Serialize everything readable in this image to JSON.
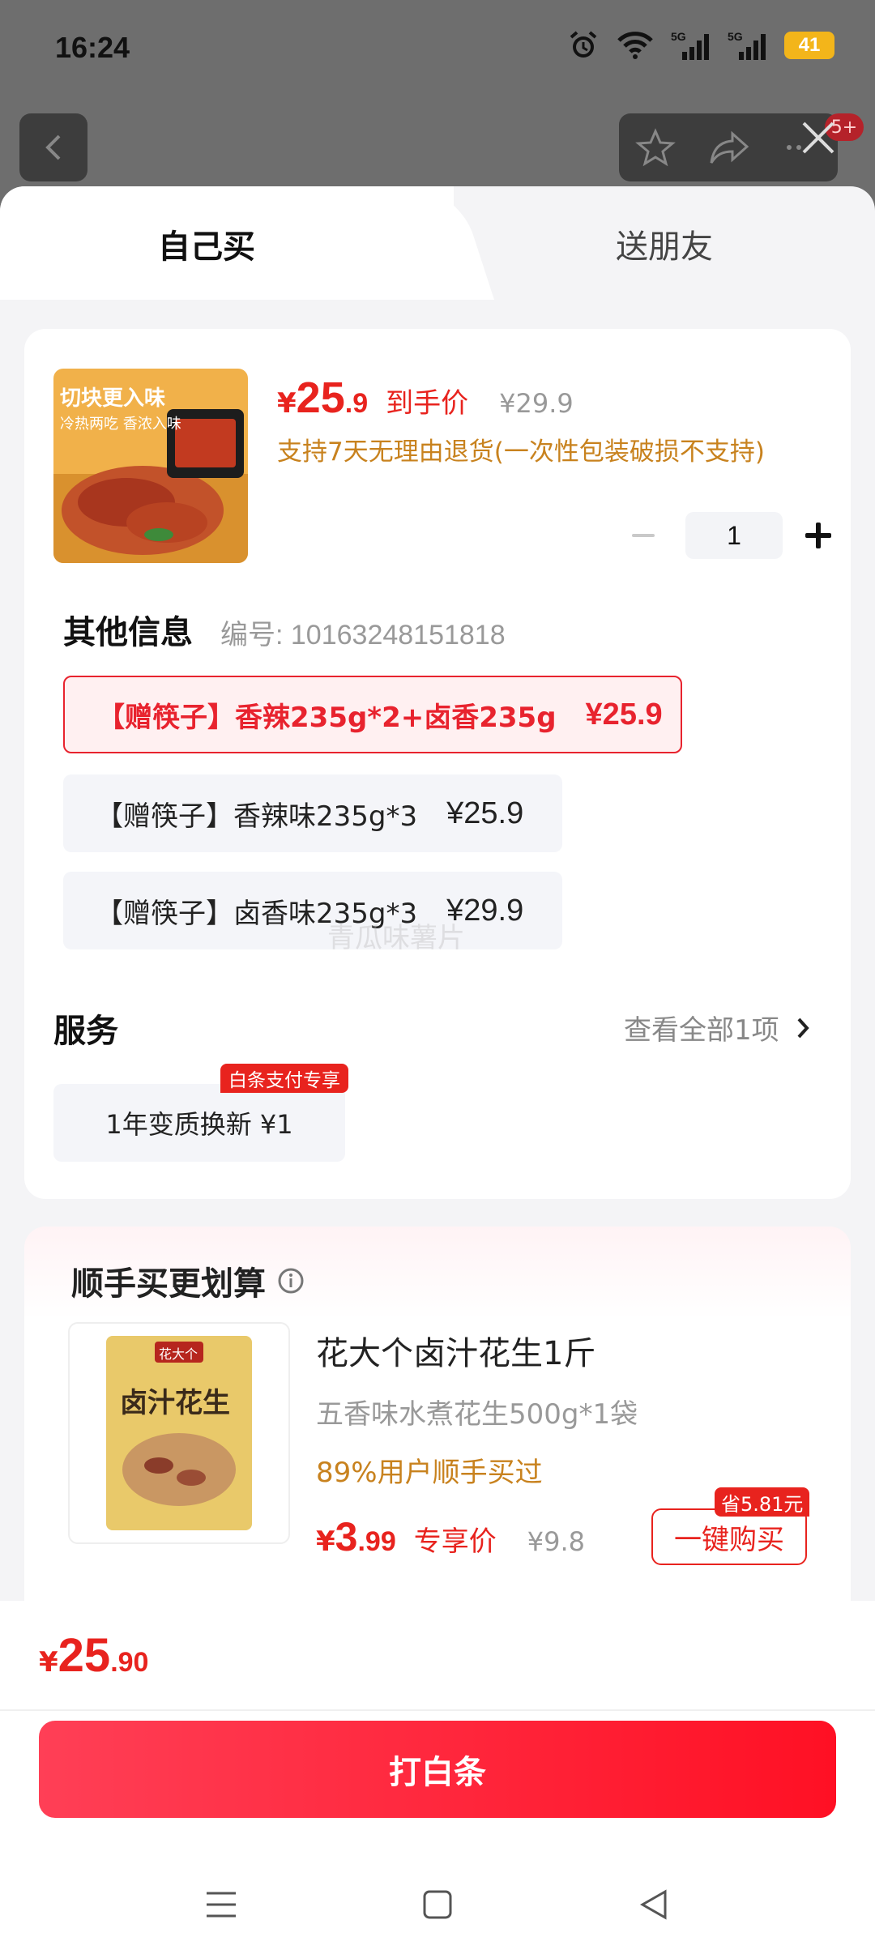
{
  "status_bar": {
    "time": "16:24",
    "battery": "41",
    "icons": [
      "alarm-icon",
      "wifi-icon",
      "signal-5g-icon",
      "signal-5g-icon"
    ]
  },
  "background": {
    "badge": "5+",
    "icons": [
      "back-icon",
      "star-icon",
      "share-icon",
      "more-icon",
      "close-icon"
    ]
  },
  "tabs": [
    {
      "label": "自己买",
      "active": true
    },
    {
      "label": "送朋友",
      "active": false
    }
  ],
  "product": {
    "price_yen": "¥",
    "price_int": "25",
    "price_dec": ".9",
    "price_label": "到手价",
    "original_price": "¥29.9",
    "return_note": "支持7天无理由退货(一次性包装破损不支持)",
    "image_caption_top": "切块更入味",
    "image_caption_sub": "冷热两吃 香浓入味",
    "quantity": "1"
  },
  "other_info": {
    "title": "其他信息",
    "serial": "编号: 10163248151818",
    "skus": [
      {
        "label": "【赠筷子】香辣235g*2+卤香235g",
        "price": "¥25.9",
        "selected": true
      },
      {
        "label": "【赠筷子】香辣味235g*3",
        "price": "¥25.9",
        "selected": false
      },
      {
        "label": "【赠筷子】卤香味235g*3",
        "price": "¥29.9",
        "selected": false
      }
    ],
    "watermark": "青瓜味薯片"
  },
  "service": {
    "title": "服务",
    "view_all": "查看全部1项",
    "chip": "1年变质换新 ¥1",
    "tag": "白条支付专享"
  },
  "addon": {
    "title": "顺手买更划算",
    "name": "花大个卤汁花生1斤",
    "desc": "五香味水煮花生500g*1袋",
    "users": "89%用户顺手买过",
    "price_yen": "¥",
    "price_int": "3",
    "price_dec": ".99",
    "price_label": "专享价",
    "original_price": "¥9.8",
    "save_tag": "省5.81元",
    "button": "一键购买",
    "package_brand": "花大个",
    "package_text": "卤汁花生"
  },
  "footer": {
    "total_yen": "¥",
    "total_int": "25",
    "total_dec": ".90",
    "pay_button": "打白条"
  },
  "nav": [
    "menu-icon",
    "home-icon",
    "back-triangle-icon"
  ],
  "colors": {
    "accent": "#e8231e",
    "pay_gradient_start": "#ff3f56",
    "pay_gradient_end": "#ff1024",
    "orange_text": "#c8821e"
  }
}
